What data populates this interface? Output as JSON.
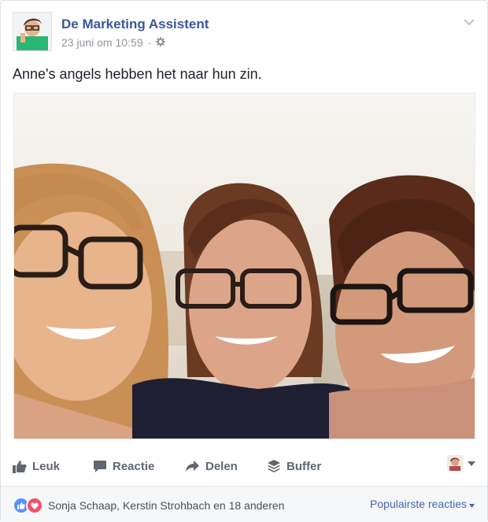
{
  "post": {
    "author": "De Marketing Assistent",
    "timestamp": "23 juni om 10:59",
    "privacy_icon": "gear-icon",
    "text": "Anne's angels hebben het naar hun zin."
  },
  "actions": {
    "like_label": "Leuk",
    "comment_label": "Reactie",
    "share_label": "Delen",
    "buffer_label": "Buffer"
  },
  "footer": {
    "reactors_text": "Sonja Schaap, Kerstin Strohbach en 18 anderen",
    "sort_label": "Populairste reacties"
  },
  "colors": {
    "author_link": "#365899",
    "action_text": "#606770",
    "like_reaction": "#5890ff",
    "love_reaction": "#f25268",
    "sort_link": "#4267b2"
  }
}
